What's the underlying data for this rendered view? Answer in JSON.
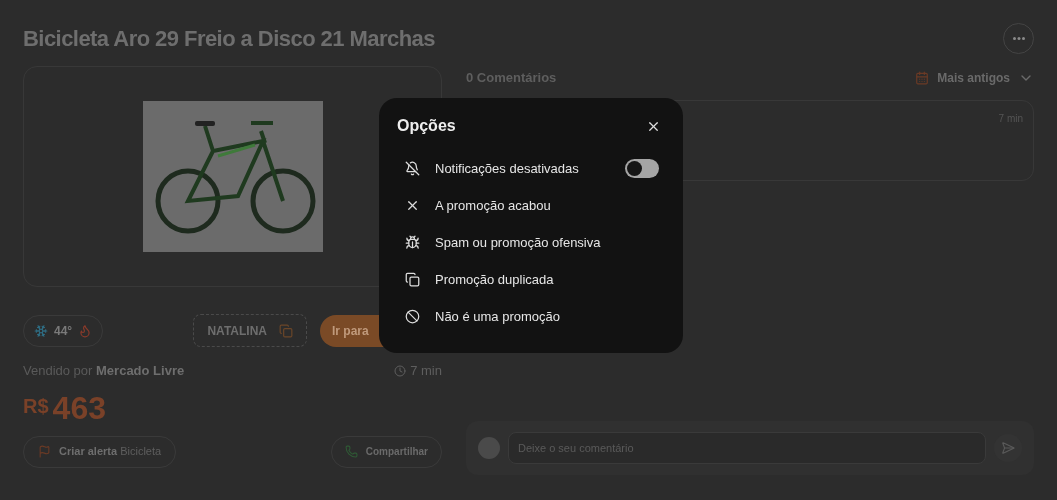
{
  "title": "Bicicleta Aro 29 Freio a Disco 21 Marchas",
  "product": {
    "temperature": "44°",
    "coupon": "NATALINA",
    "go_button": "Ir para",
    "seller_prefix": "Vendido por",
    "seller": "Mercado Livre",
    "time": "7 min",
    "currency": "R$",
    "price": "463",
    "alert_bold": "Criar alerta",
    "alert_term": "Bicicleta",
    "share": "Compartilhar"
  },
  "comments": {
    "count": "0 Comentários",
    "sort": "Mais antigos",
    "card_time": "7 min",
    "input": {
      "placeholder": "Deixe o seu comentário"
    }
  },
  "modal": {
    "title": "Opções",
    "items": [
      {
        "kind": "toggle",
        "label": "Notificações desativadas",
        "on": false
      },
      {
        "kind": "action",
        "label": "A promoção acabou"
      },
      {
        "kind": "action",
        "label": "Spam ou promoção ofensiva"
      },
      {
        "kind": "action",
        "label": "Promoção duplicada"
      },
      {
        "kind": "action",
        "label": "Não é uma promoção"
      }
    ]
  }
}
